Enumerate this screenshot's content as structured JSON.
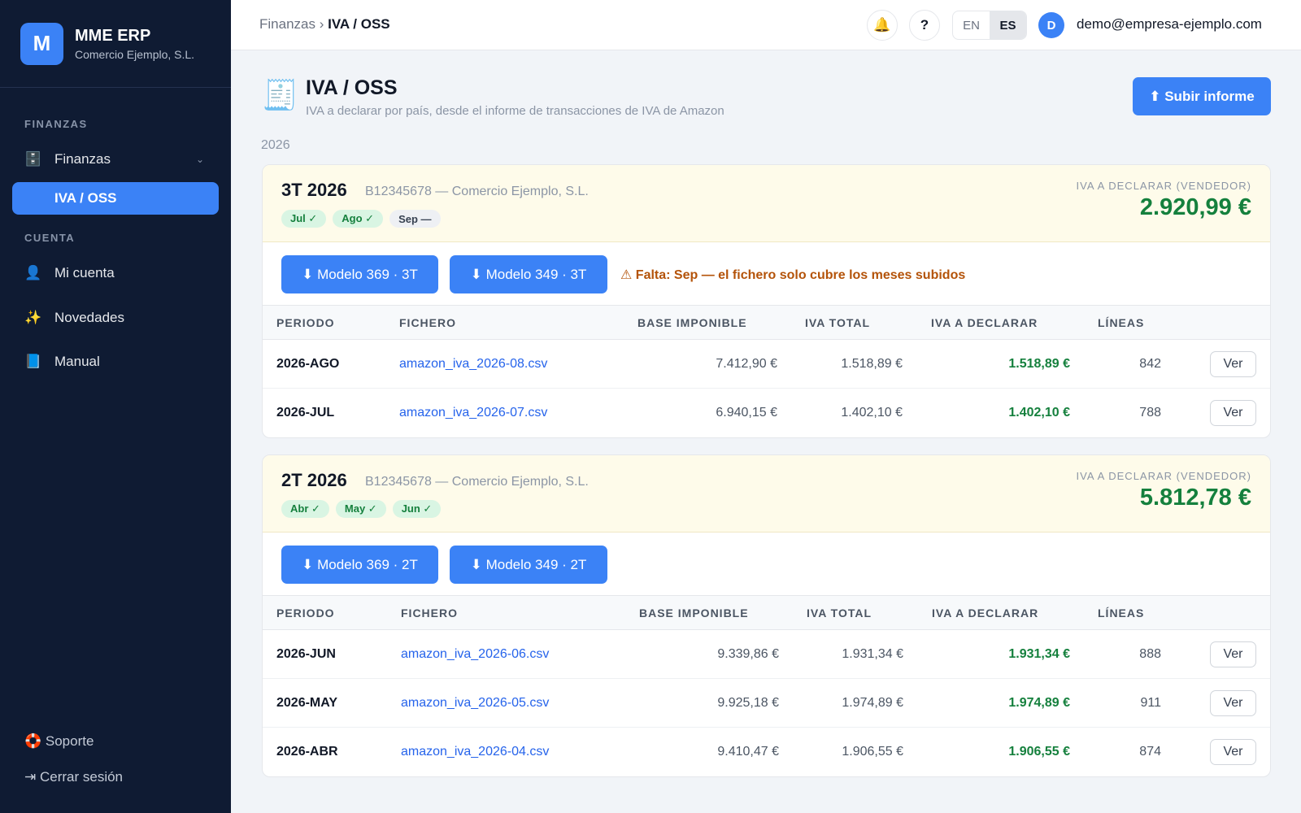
{
  "app": {
    "logo_letter": "M",
    "name": "MME ERP",
    "company": "Comercio Ejemplo, S.L."
  },
  "sidebar": {
    "section_finanzas": "FINANZAS",
    "finanzas_label": "Finanzas",
    "finanzas_icon": "cabinet-icon",
    "chevron": "⌄",
    "iva_label": "IVA / OSS",
    "section_cuenta": "CUENTA",
    "items": [
      {
        "label": "Mi cuenta",
        "icon": "user-icon",
        "glyph": "👤"
      },
      {
        "label": "Novedades",
        "icon": "sparkles-icon",
        "glyph": "✨"
      },
      {
        "label": "Manual",
        "icon": "book-icon",
        "glyph": "📘"
      }
    ],
    "support": "🛟 Soporte",
    "logout": "⇥ Cerrar sesión"
  },
  "topbar": {
    "crumb_parent": "Finanzas",
    "crumb_sep": "›",
    "crumb_current": "IVA / OSS",
    "bell": "🔔",
    "help": "?",
    "lang_en": "EN",
    "lang_es": "ES",
    "avatar": "D",
    "email": "demo@empresa-ejemplo.com"
  },
  "header": {
    "icon": "🧾",
    "title": "IVA / OSS",
    "subtitle": "IVA a declarar por país, desde el informe de transacciones de IVA de Amazon",
    "upload_label": "⬆ Subir informe",
    "year": "2026"
  },
  "table_headers": {
    "period": "PERIODO",
    "file": "FICHERO",
    "base": "BASE IMPONIBLE",
    "iva_total": "IVA TOTAL",
    "iva_declarar": "IVA A DECLARAR",
    "lines": "LÍNEAS"
  },
  "ver_label": "Ver",
  "iva_label": "IVA A DECLARAR (VENDEDOR)",
  "quarters": [
    {
      "title": "3T 2026",
      "company": "B12345678 — Comercio Ejemplo, S.L.",
      "chips": [
        {
          "label": "Jul ✓",
          "status": "ok"
        },
        {
          "label": "Ago ✓",
          "status": "ok"
        },
        {
          "label": "Sep —",
          "status": "missing"
        }
      ],
      "total": "2.920,99 €",
      "btn_369": "⬇ Modelo 369 · 3T",
      "btn_349": "⬇ Modelo 349 · 3T",
      "warning": "⚠ Falta: Sep — el fichero solo cubre los meses subidos",
      "rows": [
        {
          "period": "2026-AGO",
          "file": "amazon_iva_2026-08.csv",
          "base": "7.412,90 €",
          "iva_total": "1.518,89 €",
          "iva_declarar": "1.518,89 €",
          "lines": "842"
        },
        {
          "period": "2026-JUL",
          "file": "amazon_iva_2026-07.csv",
          "base": "6.940,15 €",
          "iva_total": "1.402,10 €",
          "iva_declarar": "1.402,10 €",
          "lines": "788"
        }
      ]
    },
    {
      "title": "2T 2026",
      "company": "B12345678 — Comercio Ejemplo, S.L.",
      "chips": [
        {
          "label": "Abr ✓",
          "status": "ok"
        },
        {
          "label": "May ✓",
          "status": "ok"
        },
        {
          "label": "Jun ✓",
          "status": "ok"
        }
      ],
      "total": "5.812,78 €",
      "btn_369": "⬇ Modelo 369 · 2T",
      "btn_349": "⬇ Modelo 349 · 2T",
      "rows": [
        {
          "period": "2026-JUN",
          "file": "amazon_iva_2026-06.csv",
          "base": "9.339,86 €",
          "iva_total": "1.931,34 €",
          "iva_declarar": "1.931,34 €",
          "lines": "888"
        },
        {
          "period": "2026-MAY",
          "file": "amazon_iva_2026-05.csv",
          "base": "9.925,18 €",
          "iva_total": "1.974,89 €",
          "iva_declarar": "1.974,89 €",
          "lines": "911"
        },
        {
          "period": "2026-ABR",
          "file": "amazon_iva_2026-04.csv",
          "base": "9.410,47 €",
          "iva_total": "1.906,55 €",
          "iva_declarar": "1.906,55 €",
          "lines": "874"
        }
      ]
    }
  ]
}
